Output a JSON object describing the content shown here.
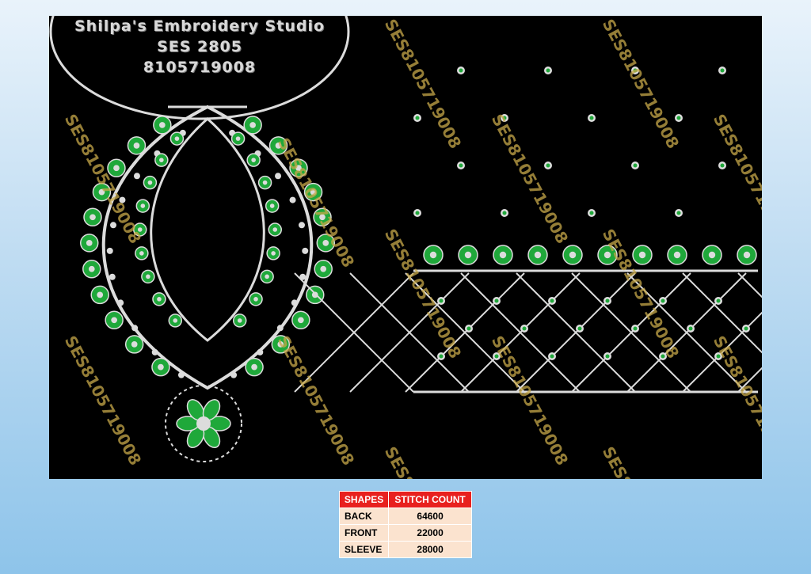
{
  "studio": {
    "name": "Shilpa's Embroidery Studio",
    "code": "SES 2805",
    "phone": "8105719008"
  },
  "watermark": "SES8105719008",
  "colors": {
    "background": "#000000",
    "thread_white": "#dcdcdc",
    "thread_green": "#1fa83a",
    "table_header": "#e8201e",
    "table_cell": "#fbe3cf"
  },
  "stitch_table": {
    "headers": [
      "SHAPES",
      "STITCH COUNT"
    ],
    "rows": [
      {
        "shape": "BACK",
        "count": "64600"
      },
      {
        "shape": "FRONT",
        "count": "22000"
      },
      {
        "shape": "SLEEVE",
        "count": "28000"
      }
    ]
  }
}
